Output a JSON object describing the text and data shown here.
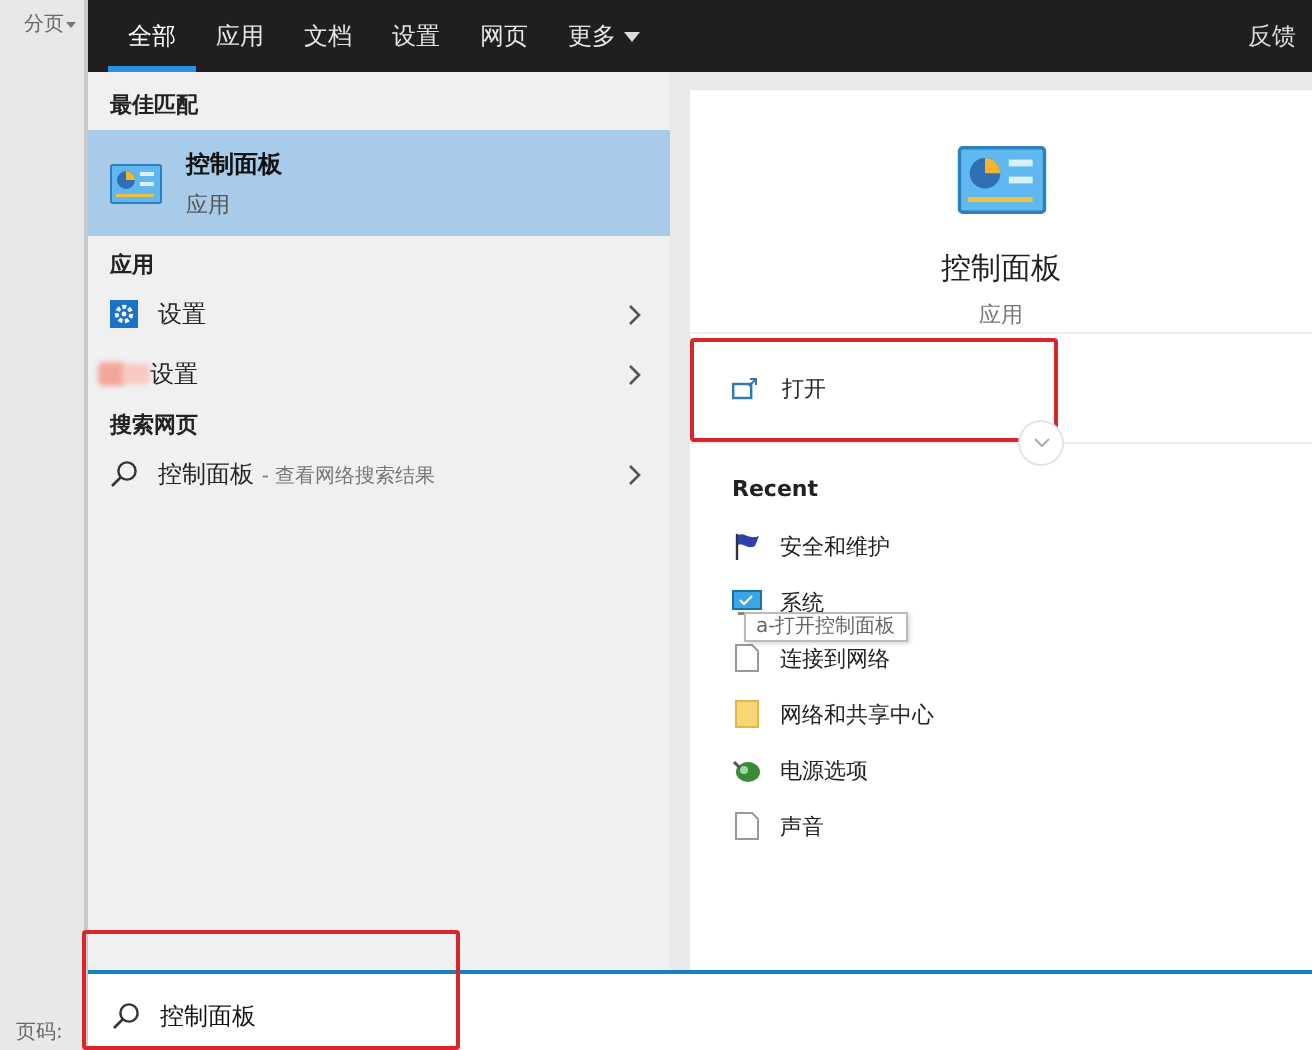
{
  "background_app": {
    "menu_label": "分页",
    "page_label": "页码:"
  },
  "tabs": [
    {
      "label": "全部",
      "selected": true,
      "kind": "plain"
    },
    {
      "label": "应用",
      "selected": false,
      "kind": "plain"
    },
    {
      "label": "文档",
      "selected": false,
      "kind": "plain"
    },
    {
      "label": "设置",
      "selected": false,
      "kind": "plain"
    },
    {
      "label": "网页",
      "selected": false,
      "kind": "plain"
    },
    {
      "label": "更多",
      "selected": false,
      "kind": "dropdown"
    }
  ],
  "feedback": "反馈",
  "best_match": {
    "heading": "最佳匹配",
    "name": "控制面板",
    "type": "应用",
    "selected": true
  },
  "apps": {
    "heading": "应用",
    "items": [
      {
        "name": "设置",
        "kind": "gear"
      },
      {
        "name": "设置",
        "kind": "blurred"
      }
    ]
  },
  "web": {
    "heading": "搜索网页",
    "query": "控制面板",
    "hint": "- 查看网络搜索结果"
  },
  "detail": {
    "name": "控制面板",
    "type": "应用",
    "actions": [
      {
        "label": "打开",
        "highlighted": true
      }
    ],
    "recent_heading": "Recent",
    "recent": [
      {
        "label": "安全和维护",
        "kind": "flag"
      },
      {
        "label": "系统",
        "kind": "monitor"
      },
      {
        "label": "连接到网络",
        "kind": "file"
      },
      {
        "label": "网络和共享中心",
        "kind": "folder"
      },
      {
        "label": "电源选项",
        "kind": "power"
      },
      {
        "label": "声音",
        "kind": "file"
      }
    ]
  },
  "tooltip": "a-打开控制面板",
  "search": {
    "value": "控制面板",
    "highlighted": true
  }
}
